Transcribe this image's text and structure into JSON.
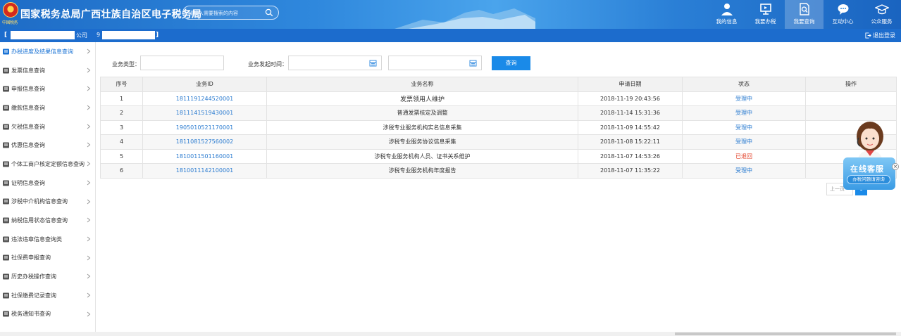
{
  "header": {
    "emblem_text": "中国税务",
    "title": "国家税务总局广西壮族自治区电子税务局",
    "search_placeholder": "请输入需要搜索的内容",
    "nav": [
      {
        "label": "我的信息",
        "icon": "user-icon",
        "active": false
      },
      {
        "label": "我要办税",
        "icon": "monitor-icon",
        "active": false
      },
      {
        "label": "我要查询",
        "icon": "search-doc-icon",
        "active": true
      },
      {
        "label": "互动中心",
        "icon": "chat-icon",
        "active": false
      },
      {
        "label": "公众服务",
        "icon": "graduation-cap-icon",
        "active": false
      }
    ]
  },
  "account": {
    "bracket_left": "[",
    "name_suffix": "公司",
    "id_prefix": "9",
    "bracket_right": "]",
    "logout": "退出登录"
  },
  "sidebar": {
    "items": [
      {
        "label": "办税进度及结果信息查询",
        "icon": "progress-icon",
        "active": true
      },
      {
        "label": "发票信息查询",
        "icon": "invoice-icon",
        "active": false
      },
      {
        "label": "申报信息查询",
        "icon": "declare-icon",
        "active": false
      },
      {
        "label": "缴款信息查询",
        "icon": "payment-icon",
        "active": false
      },
      {
        "label": "欠税信息查询",
        "icon": "arrears-icon",
        "active": false
      },
      {
        "label": "优惠信息查询",
        "icon": "discount-icon",
        "active": false
      },
      {
        "label": "个体工商户核定定额信息查询",
        "icon": "merchant-icon",
        "active": false
      },
      {
        "label": "证明信息查询",
        "icon": "certificate-icon",
        "active": false
      },
      {
        "label": "涉税中介机构信息查询",
        "icon": "agency-icon",
        "active": false
      },
      {
        "label": "纳税信用状态信息查询",
        "icon": "credit-icon",
        "active": false
      },
      {
        "label": "违法违章信息查询类",
        "icon": "violation-icon",
        "active": false
      },
      {
        "label": "社保费申报查询",
        "icon": "social-insurance-icon",
        "active": false
      },
      {
        "label": "历史办税操作查询",
        "icon": "history-icon",
        "active": false
      },
      {
        "label": "社保缴费记录查询",
        "icon": "social-payment-icon",
        "active": false
      },
      {
        "label": "税务通知书查询",
        "icon": "notice-icon",
        "active": false
      }
    ]
  },
  "filters": {
    "type_label": "业务类型：",
    "type_value": "",
    "time_label": "业务发起时间：",
    "start_date": "",
    "end_date": "",
    "query_button": "查询"
  },
  "table": {
    "headers": [
      "序号",
      "业务ID",
      "业务名称",
      "申请日期",
      "状态",
      "操作"
    ],
    "rows": [
      {
        "no": "1",
        "id": "1811191244520001",
        "name": "发票领用人维护",
        "date": "2018-11-19 20:43:56",
        "status": "受理中",
        "status_color": "#2a7bd0",
        "op": ""
      },
      {
        "no": "2",
        "id": "1811141519430001",
        "name": "普通发票核定及调整",
        "date": "2018-11-14 15:31:36",
        "status": "受理中",
        "status_color": "#2a7bd0",
        "op": ""
      },
      {
        "no": "3",
        "id": "1905010521170001",
        "name": "涉税专业服务机构实名信息采集",
        "date": "2018-11-09 14:55:42",
        "status": "受理中",
        "status_color": "#2a7bd0",
        "op": ""
      },
      {
        "no": "4",
        "id": "1811081527560002",
        "name": "涉税专业服务协议信息采集",
        "date": "2018-11-08 15:22:11",
        "status": "受理中",
        "status_color": "#2a7bd0",
        "op": ""
      },
      {
        "no": "5",
        "id": "1810011501160001",
        "name": "涉税专业服务机构人员、证书关系维护",
        "date": "2018-11-07 14:53:26",
        "status": "已退回",
        "status_color": "#e3462e",
        "op": ""
      },
      {
        "no": "6",
        "id": "1810011142100001",
        "name": "涉税专业服务机构年度报告",
        "date": "2018-11-07 11:35:22",
        "status": "受理中",
        "status_color": "#2a7bd0",
        "op": ""
      }
    ]
  },
  "pager": {
    "prev": "上一页",
    "current": "1"
  },
  "customer_service": {
    "title": "在线客服",
    "subtitle": "办税问题请咨询",
    "close": "×"
  }
}
